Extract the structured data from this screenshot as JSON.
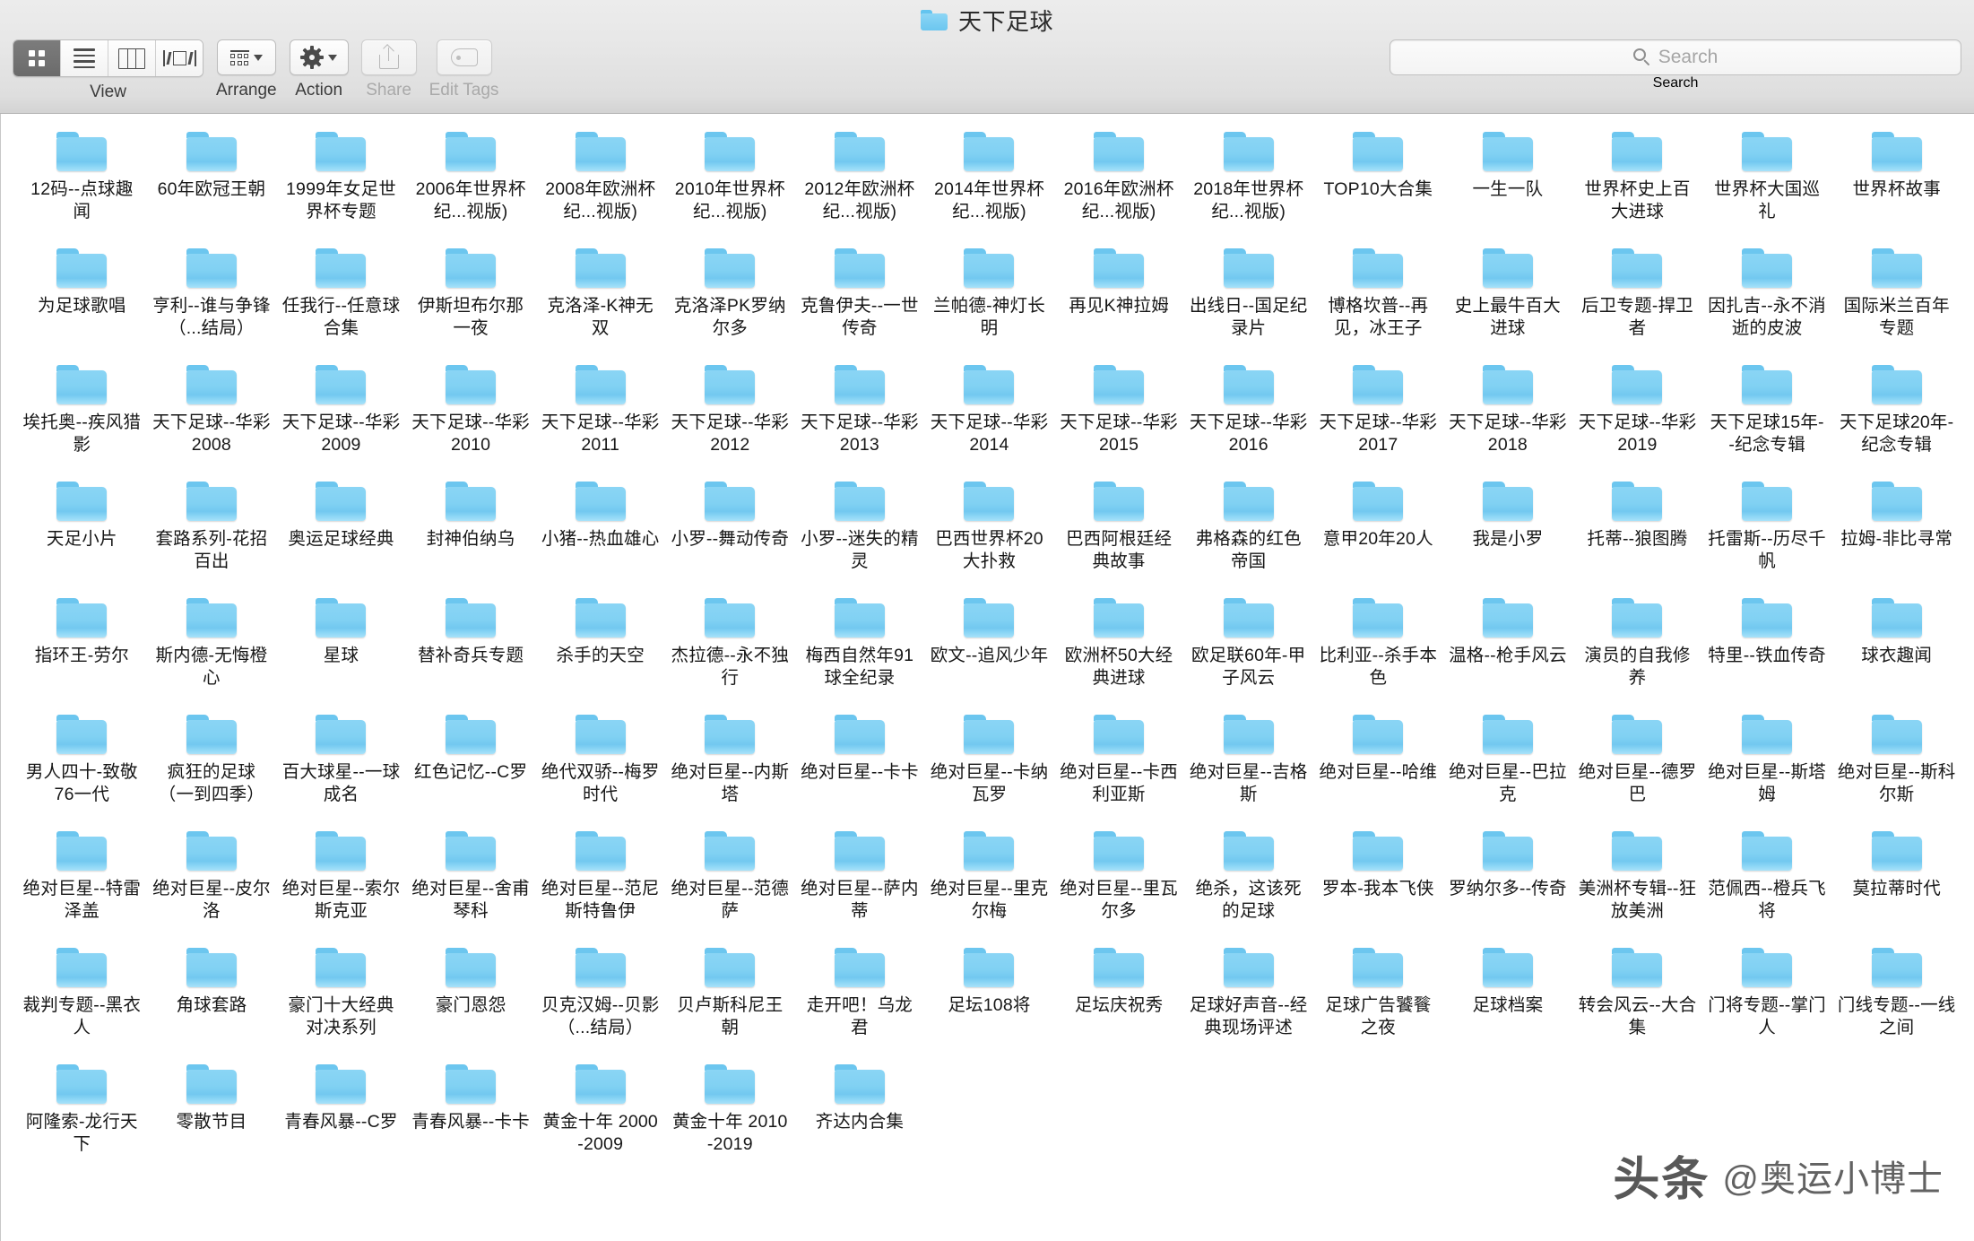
{
  "window": {
    "title": "天下足球",
    "folder_icon": "folder-icon"
  },
  "toolbar": {
    "view": {
      "label": "View",
      "segments": [
        {
          "name": "icon-view",
          "icon": "grid-icon",
          "active": true
        },
        {
          "name": "list-view",
          "icon": "list-icon",
          "active": false
        },
        {
          "name": "column-view",
          "icon": "columns-icon",
          "active": false
        },
        {
          "name": "gallery-view",
          "icon": "coverflow-icon",
          "active": false
        }
      ]
    },
    "arrange": {
      "label": "Arrange",
      "icon": "arrange-icon",
      "chevron": "chevron-down-icon"
    },
    "action": {
      "label": "Action",
      "icon": "gear-icon",
      "chevron": "chevron-down-icon"
    },
    "share": {
      "label": "Share",
      "icon": "share-icon",
      "disabled": true
    },
    "edit_tags": {
      "label": "Edit Tags",
      "icon": "tag-icon",
      "disabled": true
    },
    "search": {
      "label": "Search",
      "placeholder": "Search",
      "value": "",
      "icon": "search-icon"
    }
  },
  "watermark": {
    "logo": "头条",
    "text": "@奥运小博士"
  },
  "files": [
    {
      "name": "12码--点球趣闻"
    },
    {
      "name": "60年欧冠王朝"
    },
    {
      "name": "1999年女足世界杯专题"
    },
    {
      "name": "2006年世界杯纪...视版)"
    },
    {
      "name": "2008年欧洲杯纪...视版)"
    },
    {
      "name": "2010年世界杯纪...视版)"
    },
    {
      "name": "2012年欧洲杯纪...视版)"
    },
    {
      "name": "2014年世界杯纪...视版)"
    },
    {
      "name": "2016年欧洲杯纪...视版)"
    },
    {
      "name": "2018年世界杯纪...视版)"
    },
    {
      "name": "TOP10大合集"
    },
    {
      "name": "一生一队"
    },
    {
      "name": "世界杯史上百大进球"
    },
    {
      "name": "世界杯大国巡礼"
    },
    {
      "name": "世界杯故事"
    },
    {
      "name": "为足球歌唱"
    },
    {
      "name": "亨利--谁与争锋（...结局）"
    },
    {
      "name": "任我行--任意球合集"
    },
    {
      "name": "伊斯坦布尔那一夜"
    },
    {
      "name": "克洛泽-K神无双"
    },
    {
      "name": "克洛泽PK罗纳尔多"
    },
    {
      "name": "克鲁伊夫--一世传奇"
    },
    {
      "name": "兰帕德-神灯长明"
    },
    {
      "name": "再见K神拉姆"
    },
    {
      "name": "出线日--国足纪录片"
    },
    {
      "name": "博格坎普--再见，冰王子"
    },
    {
      "name": "史上最牛百大进球"
    },
    {
      "name": "后卫专题-捍卫者"
    },
    {
      "name": "因扎吉--永不消逝的皮波"
    },
    {
      "name": "国际米兰百年专题"
    },
    {
      "name": "埃托奥--疾风猎影"
    },
    {
      "name": "天下足球--华彩2008"
    },
    {
      "name": "天下足球--华彩2009"
    },
    {
      "name": "天下足球--华彩2010"
    },
    {
      "name": "天下足球--华彩2011"
    },
    {
      "name": "天下足球--华彩2012"
    },
    {
      "name": "天下足球--华彩2013"
    },
    {
      "name": "天下足球--华彩2014"
    },
    {
      "name": "天下足球--华彩2015"
    },
    {
      "name": "天下足球--华彩2016"
    },
    {
      "name": "天下足球--华彩2017"
    },
    {
      "name": "天下足球--华彩2018"
    },
    {
      "name": "天下足球--华彩2019"
    },
    {
      "name": "天下足球15年--纪念专辑"
    },
    {
      "name": "天下足球20年-纪念专辑"
    },
    {
      "name": "天足小片"
    },
    {
      "name": "套路系列-花招百出"
    },
    {
      "name": "奥运足球经典"
    },
    {
      "name": "封神伯纳乌"
    },
    {
      "name": "小猪--热血雄心"
    },
    {
      "name": "小罗--舞动传奇"
    },
    {
      "name": "小罗--迷失的精灵"
    },
    {
      "name": "巴西世界杯20大扑救"
    },
    {
      "name": "巴西阿根廷经典故事"
    },
    {
      "name": "弗格森的红色帝国"
    },
    {
      "name": "意甲20年20人"
    },
    {
      "name": "我是小罗"
    },
    {
      "name": "托蒂--狼图腾"
    },
    {
      "name": "托雷斯--历尽千帆"
    },
    {
      "name": "拉姆-非比寻常"
    },
    {
      "name": "指环王-劳尔"
    },
    {
      "name": "斯内德-无悔橙心"
    },
    {
      "name": "星球"
    },
    {
      "name": "替补奇兵专题"
    },
    {
      "name": "杀手的天空"
    },
    {
      "name": "杰拉德--永不独行"
    },
    {
      "name": "梅西自然年91球全纪录"
    },
    {
      "name": "欧文--追风少年"
    },
    {
      "name": "欧洲杯50大经典进球"
    },
    {
      "name": "欧足联60年-甲子风云"
    },
    {
      "name": "比利亚--杀手本色"
    },
    {
      "name": "温格--枪手风云"
    },
    {
      "name": "演员的自我修养"
    },
    {
      "name": "特里--铁血传奇"
    },
    {
      "name": "球衣趣闻"
    },
    {
      "name": "男人四十-致敬76一代"
    },
    {
      "name": "疯狂的足球（一到四季）"
    },
    {
      "name": "百大球星--一球成名"
    },
    {
      "name": "红色记忆--C罗"
    },
    {
      "name": "绝代双骄--梅罗时代"
    },
    {
      "name": "绝对巨星--内斯塔"
    },
    {
      "name": "绝对巨星--卡卡"
    },
    {
      "name": "绝对巨星--卡纳瓦罗"
    },
    {
      "name": "绝对巨星--卡西利亚斯"
    },
    {
      "name": "绝对巨星--吉格斯"
    },
    {
      "name": "绝对巨星--哈维"
    },
    {
      "name": "绝对巨星--巴拉克"
    },
    {
      "name": "绝对巨星--德罗巴"
    },
    {
      "name": "绝对巨星--斯塔姆"
    },
    {
      "name": "绝对巨星--斯科尔斯"
    },
    {
      "name": "绝对巨星--特雷泽盖"
    },
    {
      "name": "绝对巨星--皮尔洛"
    },
    {
      "name": "绝对巨星--索尔斯克亚"
    },
    {
      "name": "绝对巨星--舍甫琴科"
    },
    {
      "name": "绝对巨星--范尼斯特鲁伊"
    },
    {
      "name": "绝对巨星--范德萨"
    },
    {
      "name": "绝对巨星--萨内蒂"
    },
    {
      "name": "绝对巨星--里克尔梅"
    },
    {
      "name": "绝对巨星--里瓦尔多"
    },
    {
      "name": "绝杀，这该死的足球"
    },
    {
      "name": "罗本-我本飞侠"
    },
    {
      "name": "罗纳尔多--传奇"
    },
    {
      "name": "美洲杯专辑--狂放美洲"
    },
    {
      "name": "范佩西--橙兵飞将"
    },
    {
      "name": "莫拉蒂时代"
    },
    {
      "name": "裁判专题--黑衣人"
    },
    {
      "name": "角球套路"
    },
    {
      "name": "豪门十大经典对决系列"
    },
    {
      "name": "豪门恩怨"
    },
    {
      "name": "贝克汉姆--贝影（...结局）"
    },
    {
      "name": "贝卢斯科尼王朝"
    },
    {
      "name": "走开吧！乌龙君"
    },
    {
      "name": "足坛108将"
    },
    {
      "name": "足坛庆祝秀"
    },
    {
      "name": "足球好声音--经典现场评述"
    },
    {
      "name": "足球广告饕餮之夜"
    },
    {
      "name": "足球档案"
    },
    {
      "name": "转会风云--大合集"
    },
    {
      "name": "门将专题--掌门人"
    },
    {
      "name": "门线专题--一线之间"
    },
    {
      "name": "阿隆索-龙行天下"
    },
    {
      "name": "零散节目"
    },
    {
      "name": "青春风暴--C罗"
    },
    {
      "name": "青春风暴--卡卡"
    },
    {
      "name": "黄金十年 2000-2009"
    },
    {
      "name": "黄金十年 2010-2019"
    },
    {
      "name": "齐达内合集"
    }
  ]
}
